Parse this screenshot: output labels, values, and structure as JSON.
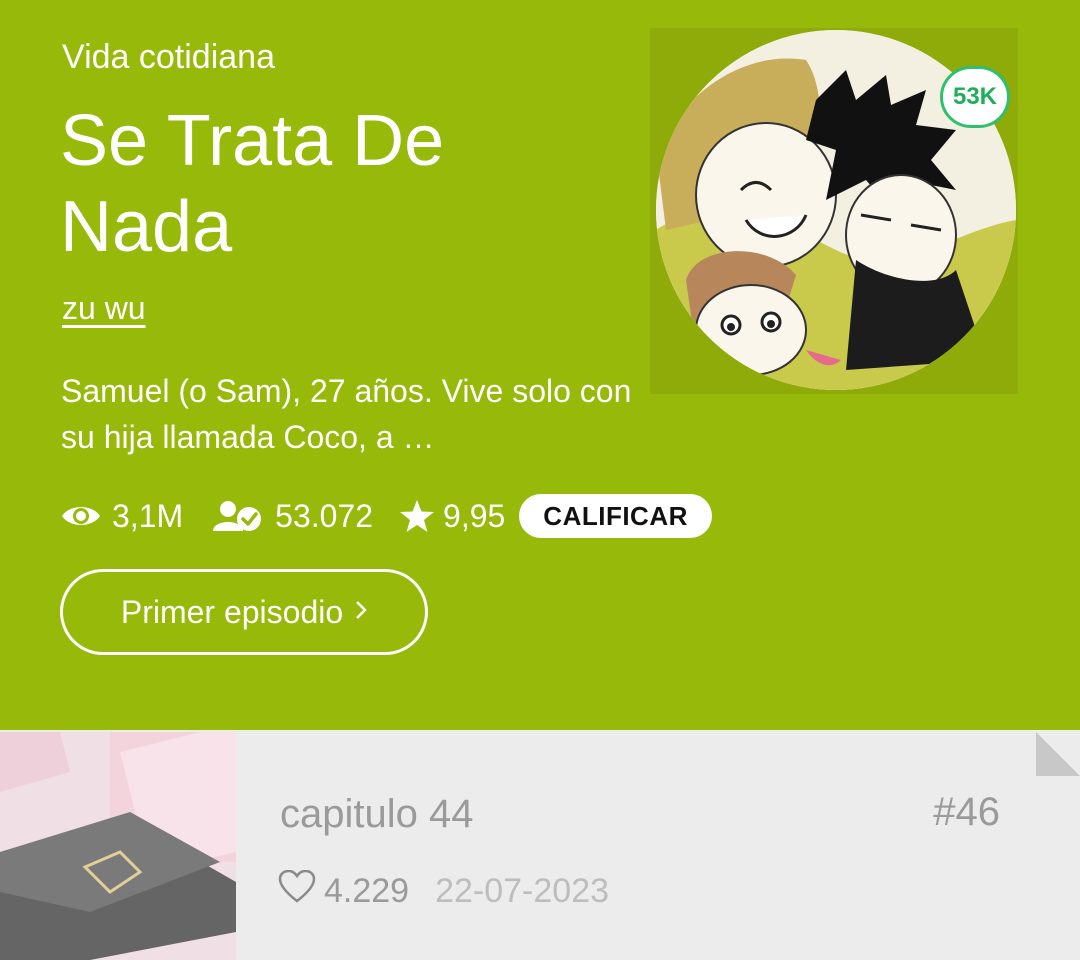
{
  "series": {
    "genre": "Vida cotidiana",
    "title": "Se Trata De Nada",
    "author": "zu wu",
    "description": "Samuel (o Sam), 27 años. Vive solo con su hija llamada Coco, a …",
    "subscriber_badge": "53K"
  },
  "stats": {
    "views": "3,1M",
    "subscribers": "53.072",
    "rating": "9,95",
    "rate_label": "CALIFICAR"
  },
  "first_episode_label": "Primer episodio",
  "icons": {
    "views": "eye-icon",
    "subscribers": "user-check-icon",
    "rating": "star-icon",
    "chevron": "chevron-right-icon",
    "likes": "heart-outline-icon"
  },
  "episode": {
    "title": "capitulo 44",
    "number": "#46",
    "likes": "4.229",
    "date": "22-07-2023"
  },
  "colors": {
    "hero_background": "#97b90a",
    "badge_accent": "#2ec06e",
    "episode_background": "#ececec"
  }
}
